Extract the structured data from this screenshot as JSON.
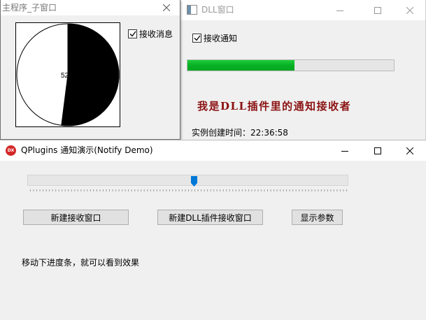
{
  "dll_window": {
    "title": "DLL窗口",
    "receive_checkbox": {
      "label": "接收通知",
      "checked": true
    },
    "progress": {
      "percent": 52,
      "fill_color": "#06b025"
    },
    "receiver_label": "我是DLL插件里的通知接收者",
    "receiver_color": "#8b1212",
    "created_time_label": "实例创建时间：",
    "created_time_value": "22:36:58"
  },
  "child_window": {
    "title": "主程序_子窗口",
    "receive_checkbox": {
      "label": "接收消息",
      "checked": true
    },
    "pie": {
      "percent": 52,
      "label": "52%",
      "fill_color": "#000000",
      "background_color": "#ffffff"
    }
  },
  "main_window": {
    "title": "QPlugins 通知演示(Notify Demo)",
    "app_icon_text": "DX",
    "app_icon_color": "#d32828",
    "slider": {
      "min": 0,
      "max": 100,
      "value": 52,
      "thumb_color": "#0078d7"
    },
    "buttons": {
      "new_receiver": "新建接收窗口",
      "new_dll_receiver": "新建DLL插件接收窗口",
      "show_params": "显示参数"
    },
    "hint": "移动下进度条，就可以看到效果"
  },
  "caption_icons": [
    "minimize-icon",
    "maximize-icon",
    "close-icon"
  ]
}
